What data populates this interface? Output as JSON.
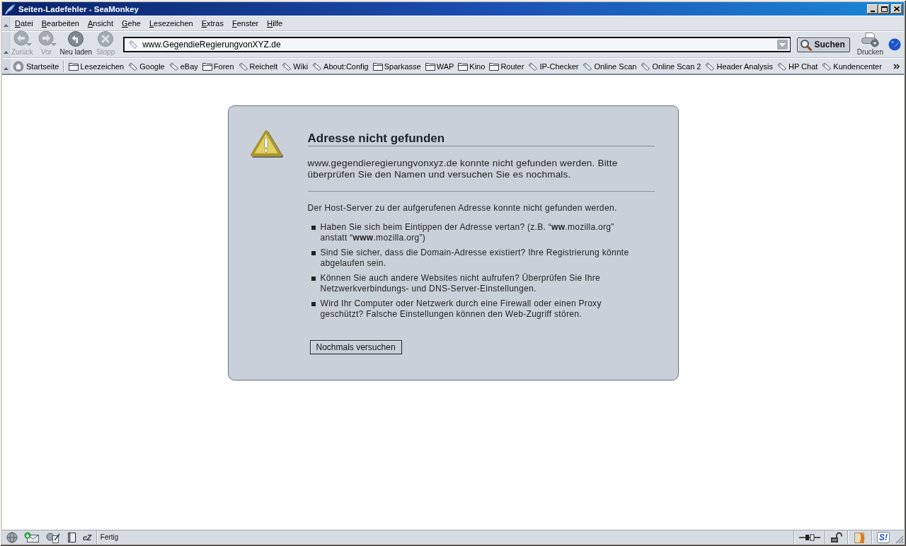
{
  "window": {
    "title": "Seiten-Ladefehler - SeaMonkey"
  },
  "menu_bar": {
    "items": [
      {
        "label": "Datei"
      },
      {
        "label": "Bearbeiten"
      },
      {
        "label": "Ansicht"
      },
      {
        "label": "Gehe"
      },
      {
        "label": "Lesezeichen"
      },
      {
        "label": "Extras"
      },
      {
        "label": "Fenster"
      },
      {
        "label": "Hilfe"
      }
    ]
  },
  "navigation_toolbar": {
    "buttons": [
      {
        "kind": "back",
        "label": "Zurück",
        "disabled": true
      },
      {
        "kind": "forward",
        "label": "Vor",
        "disabled": true
      },
      {
        "kind": "reload",
        "label": "Neu laden",
        "disabled": false
      },
      {
        "kind": "stop",
        "label": "Stopp",
        "disabled": true
      }
    ],
    "address_field": {
      "value": "www.GegendieRegierungvonXYZ.de"
    },
    "search_button": {
      "label": "Suchen"
    },
    "print_button": {
      "label": "Drucken"
    }
  },
  "bookmarks_toolbar": {
    "home_button": {
      "label": "Startseite"
    },
    "items": [
      {
        "kind": "folder",
        "label": "Lesezeichen"
      },
      {
        "kind": "bookmark",
        "label": "Google"
      },
      {
        "kind": "bookmark",
        "label": "eBay"
      },
      {
        "kind": "folder",
        "label": "Foren"
      },
      {
        "kind": "bookmark",
        "label": "Reichelt"
      },
      {
        "kind": "bookmark",
        "label": "Wiki"
      },
      {
        "kind": "bookmark",
        "label": "About:Config"
      },
      {
        "kind": "folder",
        "label": "Sparkasse"
      },
      {
        "kind": "folder",
        "label": "WAP"
      },
      {
        "kind": "folder",
        "label": "Kino"
      },
      {
        "kind": "folder",
        "label": "Router"
      },
      {
        "kind": "bookmark",
        "label": "IP-Checker"
      },
      {
        "kind": "bookmark",
        "label": "Online Scan"
      },
      {
        "kind": "bookmark",
        "label": "Online Scan 2"
      },
      {
        "kind": "bookmark",
        "label": "Header Analysis"
      },
      {
        "kind": "bookmark",
        "label": "HP Chat"
      },
      {
        "kind": "bookmark",
        "label": "Kundencenter"
      }
    ]
  },
  "error_page": {
    "title": "Adresse nicht gefunden",
    "short_description": "www.gegendieregierungvonxyz.de konnte nicht gefunden werden. Bitte überprüfen Sie den Namen und versuchen Sie es nochmals.",
    "long_description": "Der Host-Server zu der aufgerufenen Adresse konnte nicht gefunden werden.",
    "suggestions": [
      "Haben Sie sich beim Eintippen der Adresse vertan? (z.B. “**ww**.mozilla.org” anstatt “**www**.mozilla.org”)",
      "Sind Sie sicher, dass die Domain-Adresse existiert? Ihre Registrierung könnte abgelaufen sein.",
      "Können Sie auch andere Websites nicht aufrufen? Überprüfen Sie Ihre Netzwerkverbindungs- und DNS-Server-Einstellungen.",
      "Wird Ihr Computer oder Netzwerk durch eine Firewall oder einen Proxy geschützt? Falsche Einstellungen können den Web-Zugriff stören."
    ],
    "retry_button": {
      "label": "Nochmals versuchen"
    }
  },
  "status_bar": {
    "components": [
      {
        "kind": "browser"
      },
      {
        "kind": "mail"
      },
      {
        "kind": "composer"
      },
      {
        "kind": "address_book"
      },
      {
        "kind": "chat",
        "label": "cZ"
      }
    ],
    "text": "Fertig",
    "indicators": [
      {
        "kind": "connection"
      },
      {
        "kind": "security"
      },
      {
        "kind": "extension"
      },
      {
        "kind": "badge",
        "label": "S!"
      }
    ]
  }
}
